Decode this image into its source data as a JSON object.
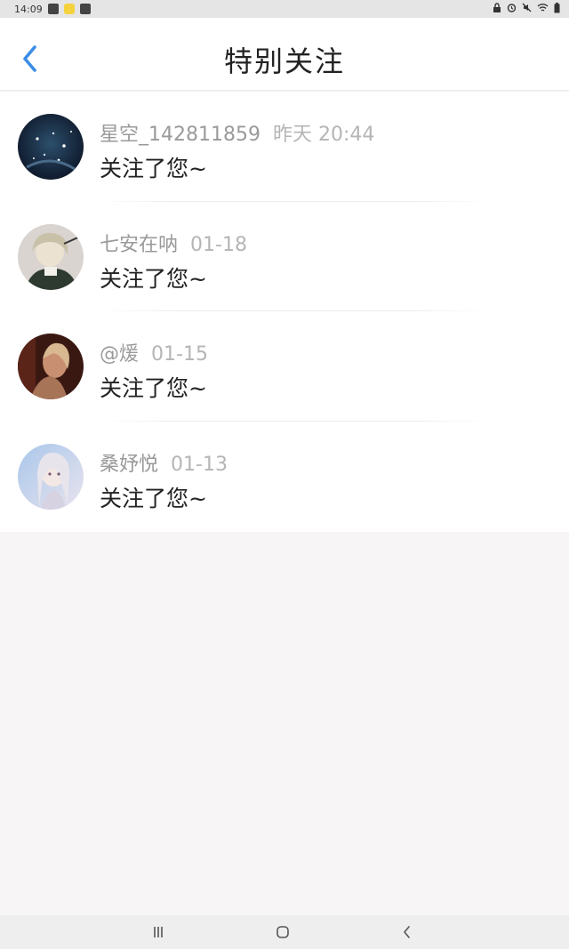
{
  "status_bar": {
    "time": "14:09"
  },
  "header": {
    "title": "特别关注"
  },
  "items": [
    {
      "name": "星空_142811859",
      "time": "昨天 20:44",
      "message": "关注了您~",
      "avatar_colors": [
        "#0c1526",
        "#2c4f6c"
      ]
    },
    {
      "name": "七安在呐",
      "time": "01-18",
      "message": "关注了您~",
      "avatar_colors": [
        "#d9d4cf",
        "#2e3a30"
      ]
    },
    {
      "name": "@煖",
      "time": "01-15",
      "message": "关注了您~",
      "avatar_colors": [
        "#3a1812",
        "#c89070"
      ]
    },
    {
      "name": "桑妤悦",
      "time": "01-13",
      "message": "关注了您~",
      "avatar_colors": [
        "#a9c7ea",
        "#e8e3ee"
      ]
    }
  ],
  "colors": {
    "accent": "#3a8ee6",
    "background": "#f7f5f5"
  }
}
